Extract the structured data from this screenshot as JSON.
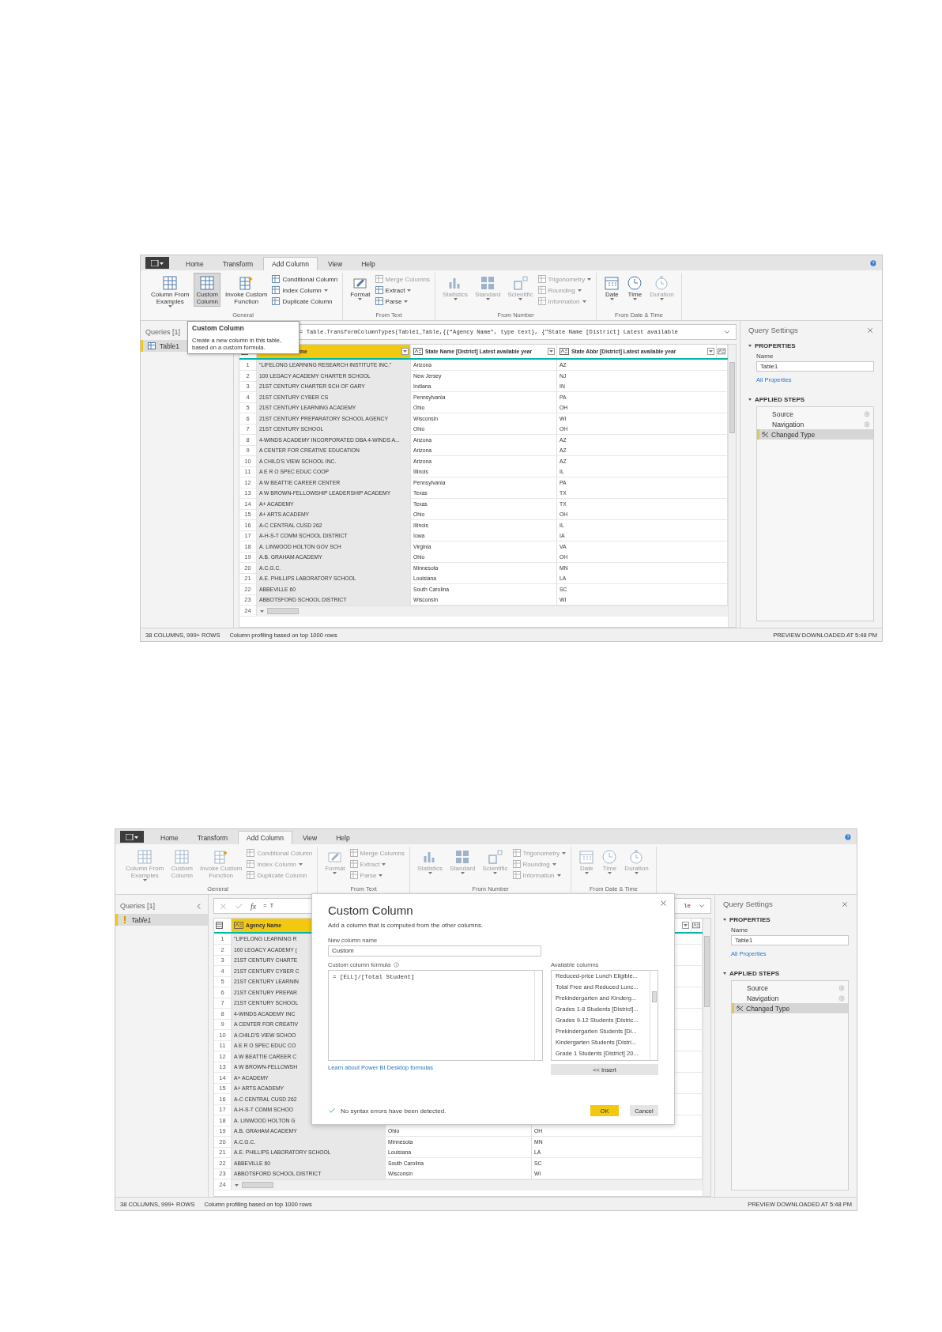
{
  "screenshots": [
    {
      "tabs": [
        {
          "label": "Home",
          "selected": false
        },
        {
          "label": "Transform",
          "selected": false
        },
        {
          "label": "Add Column",
          "selected": true
        },
        {
          "label": "View",
          "selected": false
        },
        {
          "label": "Help",
          "selected": false
        }
      ],
      "ribbon": {
        "groups": [
          {
            "label": "General",
            "buttons": [
              {
                "kind": "large",
                "lines": [
                  "Column From",
                  "Examples"
                ],
                "dropdown": true,
                "disabled": false,
                "highlighted": false
              },
              {
                "kind": "large",
                "lines": [
                  "Custom",
                  "Column"
                ],
                "dropdown": false,
                "disabled": false,
                "highlighted": true
              },
              {
                "kind": "large",
                "lines": [
                  "Invoke Custom",
                  "Function"
                ],
                "dropdown": false,
                "disabled": false,
                "highlighted": false
              },
              {
                "kind": "small",
                "label": "Conditional Column",
                "dropdown": false,
                "disabled": false
              },
              {
                "kind": "small",
                "label": "Index Column",
                "dropdown": true,
                "disabled": false
              },
              {
                "kind": "small",
                "label": "Duplicate Column",
                "dropdown": false,
                "disabled": false
              }
            ]
          },
          {
            "label": "From Text",
            "buttons": [
              {
                "kind": "large",
                "lines": [
                  "Format"
                ],
                "dropdown": true,
                "disabled": false,
                "highlighted": false
              },
              {
                "kind": "small",
                "label": "Merge Columns",
                "dropdown": false,
                "disabled": true
              },
              {
                "kind": "small",
                "label": "Extract",
                "dropdown": true,
                "disabled": false
              },
              {
                "kind": "small",
                "label": "Parse",
                "dropdown": true,
                "disabled": false
              }
            ]
          },
          {
            "label": "From Number",
            "buttons": [
              {
                "kind": "large",
                "lines": [
                  "Statistics"
                ],
                "dropdown": true,
                "disabled": true,
                "highlighted": false
              },
              {
                "kind": "large",
                "lines": [
                  "Standard"
                ],
                "dropdown": true,
                "disabled": true,
                "highlighted": false
              },
              {
                "kind": "large",
                "lines": [
                  "Scientific"
                ],
                "dropdown": true,
                "disabled": true,
                "highlighted": false
              },
              {
                "kind": "small",
                "label": "Trigonometry",
                "dropdown": true,
                "disabled": true
              },
              {
                "kind": "small",
                "label": "Rounding",
                "dropdown": true,
                "disabled": true
              },
              {
                "kind": "small",
                "label": "Information",
                "dropdown": true,
                "disabled": true
              }
            ]
          },
          {
            "label": "From Date & Time",
            "buttons": [
              {
                "kind": "large",
                "lines": [
                  "Date"
                ],
                "dropdown": true,
                "disabled": false,
                "highlighted": false
              },
              {
                "kind": "large",
                "lines": [
                  "Time"
                ],
                "dropdown": true,
                "disabled": false,
                "highlighted": false
              },
              {
                "kind": "large",
                "lines": [
                  "Duration"
                ],
                "dropdown": true,
                "disabled": true,
                "highlighted": false
              }
            ]
          }
        ]
      },
      "queries": {
        "title": "Queries [1]",
        "items": [
          {
            "label": "Table1",
            "selected": true,
            "warning": false
          }
        ]
      },
      "formula_bar": {
        "controls": false,
        "text": "= Table.TransformColumnTypes(Table1_Table,{{\"Agency Name\", type text}, {\"State Name [District] Latest available"
      },
      "grid": {
        "columns": [
          {
            "label": "me",
            "selected": true,
            "type_icon": false,
            "dropdown": true
          },
          {
            "label": "State Name [District] Latest available year",
            "selected": false,
            "type_icon": true,
            "dropdown": true
          },
          {
            "label": "State Abbr [District] Latest available year",
            "selected": false,
            "type_icon": true,
            "dropdown": true
          }
        ],
        "rows": [
          {
            "n": "1",
            "cells": [
              "\"LIFELONG LEARNING RESEARCH INSTITUTE INC.\"",
              "Arizona",
              "AZ"
            ]
          },
          {
            "n": "2",
            "cells": [
              "100 LEGACY ACADEMY CHARTER SCHOOL",
              "New Jersey",
              "NJ"
            ]
          },
          {
            "n": "3",
            "cells": [
              "21ST CENTURY CHARTER SCH OF GARY",
              "Indiana",
              "IN"
            ]
          },
          {
            "n": "4",
            "cells": [
              "21ST CENTURY CYBER CS",
              "Pennsylvania",
              "PA"
            ]
          },
          {
            "n": "5",
            "cells": [
              "21ST CENTURY LEARNING ACADEMY",
              "Ohio",
              "OH"
            ]
          },
          {
            "n": "6",
            "cells": [
              "21ST CENTURY PREPARATORY SCHOOL AGENCY",
              "Wisconsin",
              "WI"
            ]
          },
          {
            "n": "7",
            "cells": [
              "21ST CENTURY SCHOOL",
              "Ohio",
              "OH"
            ]
          },
          {
            "n": "8",
            "cells": [
              "4-WINDS ACADEMY INCORPORATED DBA 4-WINDS A...",
              "Arizona",
              "AZ"
            ]
          },
          {
            "n": "9",
            "cells": [
              "A CENTER FOR CREATIVE EDUCATION",
              "Arizona",
              "AZ"
            ]
          },
          {
            "n": "10",
            "cells": [
              "A CHILD'S VIEW SCHOOL INC.",
              "Arizona",
              "AZ"
            ]
          },
          {
            "n": "11",
            "cells": [
              "A E R O SPEC EDUC COOP",
              "Illinois",
              "IL"
            ]
          },
          {
            "n": "12",
            "cells": [
              "A W BEATTIE CAREER CENTER",
              "Pennsylvania",
              "PA"
            ]
          },
          {
            "n": "13",
            "cells": [
              "A W BROWN-FELLOWSHIP LEADERSHIP ACADEMY",
              "Texas",
              "TX"
            ]
          },
          {
            "n": "14",
            "cells": [
              "A+ ACADEMY",
              "Texas",
              "TX"
            ]
          },
          {
            "n": "15",
            "cells": [
              "A+ ARTS ACADEMY",
              "Ohio",
              "OH"
            ]
          },
          {
            "n": "16",
            "cells": [
              "A-C CENTRAL CUSD 262",
              "Illinois",
              "IL"
            ]
          },
          {
            "n": "17",
            "cells": [
              "A-H-S-T COMM SCHOOL DISTRICT",
              "Iowa",
              "IA"
            ]
          },
          {
            "n": "18",
            "cells": [
              "A. LINWOOD HOLTON GOV SCH",
              "Virginia",
              "VA"
            ]
          },
          {
            "n": "19",
            "cells": [
              "A.B. GRAHAM ACADEMY",
              "Ohio",
              "OH"
            ]
          },
          {
            "n": "20",
            "cells": [
              "A.C.G.C.",
              "Minnesota",
              "MN"
            ]
          },
          {
            "n": "21",
            "cells": [
              "A.E. PHILLIPS LABORATORY SCHOOL",
              "Louisiana",
              "LA"
            ]
          },
          {
            "n": "22",
            "cells": [
              "ABBEVILLE 60",
              "South Carolina",
              "SC"
            ]
          },
          {
            "n": "23",
            "cells": [
              "ABBOTSFORD SCHOOL DISTRICT",
              "Wisconsin",
              "WI"
            ]
          }
        ],
        "last_row": "24"
      },
      "settings": {
        "title": "Query Settings",
        "properties_heading": "PROPERTIES",
        "name_label": "Name",
        "name_value": "Table1",
        "link": "All Properties",
        "steps_heading": "APPLIED STEPS",
        "steps": [
          {
            "label": "Source",
            "selected": false,
            "kind": "configurable"
          },
          {
            "label": "Navigation",
            "selected": false,
            "kind": "configurable"
          },
          {
            "label": "Changed Type",
            "selected": true,
            "kind": "transform"
          }
        ]
      },
      "status": {
        "left": [
          "38 COLUMNS, 999+ ROWS",
          "Column profiling based on top 1000 rows"
        ],
        "right": "PREVIEW DOWNLOADED AT 5:48 PM"
      },
      "tooltip": {
        "title": "Custom Column",
        "text": "Create a new column in this table, based on a custom formula."
      }
    },
    {
      "tabs": [
        {
          "label": "Home",
          "selected": false
        },
        {
          "label": "Transform",
          "selected": false
        },
        {
          "label": "Add Column",
          "selected": true
        },
        {
          "label": "View",
          "selected": false
        },
        {
          "label": "Help",
          "selected": false
        }
      ],
      "ribbon": {
        "groups": [
          {
            "label": "General",
            "buttons": [
              {
                "kind": "large",
                "lines": [
                  "Column From",
                  "Examples"
                ],
                "dropdown": true,
                "disabled": true,
                "highlighted": false
              },
              {
                "kind": "large",
                "lines": [
                  "Custom",
                  "Column"
                ],
                "dropdown": false,
                "disabled": true,
                "highlighted": false
              },
              {
                "kind": "large",
                "lines": [
                  "Invoke Custom",
                  "Function"
                ],
                "dropdown": false,
                "disabled": true,
                "highlighted": false
              },
              {
                "kind": "small",
                "label": "Conditional Column",
                "dropdown": false,
                "disabled": true
              },
              {
                "kind": "small",
                "label": "Index Column",
                "dropdown": true,
                "disabled": true
              },
              {
                "kind": "small",
                "label": "Duplicate Column",
                "dropdown": false,
                "disabled": true
              }
            ]
          },
          {
            "label": "From Text",
            "buttons": [
              {
                "kind": "large",
                "lines": [
                  "Format"
                ],
                "dropdown": true,
                "disabled": true,
                "highlighted": false
              },
              {
                "kind": "small",
                "label": "Merge Columns",
                "dropdown": false,
                "disabled": true
              },
              {
                "kind": "small",
                "label": "Extract",
                "dropdown": true,
                "disabled": true
              },
              {
                "kind": "small",
                "label": "Parse",
                "dropdown": true,
                "disabled": true
              }
            ]
          },
          {
            "label": "From Number",
            "buttons": [
              {
                "kind": "large",
                "lines": [
                  "Statistics"
                ],
                "dropdown": true,
                "disabled": true,
                "highlighted": false
              },
              {
                "kind": "large",
                "lines": [
                  "Standard"
                ],
                "dropdown": true,
                "disabled": true,
                "highlighted": false
              },
              {
                "kind": "large",
                "lines": [
                  "Scientific"
                ],
                "dropdown": true,
                "disabled": true,
                "highlighted": false
              },
              {
                "kind": "small",
                "label": "Trigonometry",
                "dropdown": true,
                "disabled": true
              },
              {
                "kind": "small",
                "label": "Rounding",
                "dropdown": true,
                "disabled": true
              },
              {
                "kind": "small",
                "label": "Information",
                "dropdown": true,
                "disabled": true
              }
            ]
          },
          {
            "label": "From Date & Time",
            "buttons": [
              {
                "kind": "large",
                "lines": [
                  "Date"
                ],
                "dropdown": true,
                "disabled": true,
                "highlighted": false
              },
              {
                "kind": "large",
                "lines": [
                  "Time"
                ],
                "dropdown": true,
                "disabled": true,
                "highlighted": false
              },
              {
                "kind": "large",
                "lines": [
                  "Duration"
                ],
                "dropdown": true,
                "disabled": true,
                "highlighted": false
              }
            ]
          }
        ]
      },
      "queries": {
        "title": "Queries [1]",
        "items": [
          {
            "label": "Table1",
            "selected": true,
            "warning": true
          }
        ]
      },
      "formula_bar": {
        "controls": true,
        "fx": "fx",
        "text": "= T",
        "tail": "le"
      },
      "grid": {
        "columns": [
          {
            "label": "Agency Name",
            "selected": true,
            "type_icon": true,
            "dropdown": false
          },
          {},
          {
            "selected": false,
            "type_icon": false,
            "dropdown": true
          }
        ],
        "rows": [
          {
            "n": "1",
            "cells": [
              "\"LIFELONG LEARNING R"
            ]
          },
          {
            "n": "2",
            "cells": [
              "100 LEGACY ACADEMY ("
            ]
          },
          {
            "n": "3",
            "cells": [
              "21ST CENTURY CHARTE"
            ]
          },
          {
            "n": "4",
            "cells": [
              "21ST CENTURY CYBER C"
            ]
          },
          {
            "n": "5",
            "cells": [
              "21ST CENTURY LEARNIN"
            ]
          },
          {
            "n": "6",
            "cells": [
              "21ST CENTURY PREPAR"
            ]
          },
          {
            "n": "7",
            "cells": [
              "21ST CENTURY SCHOOL"
            ]
          },
          {
            "n": "8",
            "cells": [
              "4-WINDS ACADEMY INC"
            ]
          },
          {
            "n": "9",
            "cells": [
              "A CENTER FOR CREATIV"
            ]
          },
          {
            "n": "10",
            "cells": [
              "A CHILD'S VIEW SCHOO"
            ]
          },
          {
            "n": "11",
            "cells": [
              "A E R O SPEC EDUC CO"
            ]
          },
          {
            "n": "12",
            "cells": [
              "A W BEATTIE CAREER C"
            ]
          },
          {
            "n": "13",
            "cells": [
              "A W BROWN-FELLOWSH"
            ]
          },
          {
            "n": "14",
            "cells": [
              "A+ ACADEMY"
            ]
          },
          {
            "n": "15",
            "cells": [
              "A+ ARTS ACADEMY"
            ]
          },
          {
            "n": "16",
            "cells": [
              "A-C CENTRAL CUSD 262"
            ]
          },
          {
            "n": "17",
            "cells": [
              "A-H-S-T COMM SCHOO"
            ]
          },
          {
            "n": "18",
            "cells": [
              "A. LINWOOD HOLTON G"
            ]
          },
          {
            "n": "19",
            "cells": [
              "A.B. GRAHAM ACADEMY",
              "Ohio",
              "OH"
            ]
          },
          {
            "n": "20",
            "cells": [
              "A.C.G.C.",
              "Minnesota",
              "MN"
            ]
          },
          {
            "n": "21",
            "cells": [
              "A.E. PHILLIPS LABORATORY SCHOOL",
              "Louisiana",
              "LA"
            ]
          },
          {
            "n": "22",
            "cells": [
              "ABBEVILLE 60",
              "South Carolina",
              "SC"
            ]
          },
          {
            "n": "23",
            "cells": [
              "ABBOTSFORD SCHOOL DISTRICT",
              "Wisconsin",
              "WI"
            ]
          }
        ],
        "last_row": "24"
      },
      "settings": {
        "title": "Query Settings",
        "properties_heading": "PROPERTIES",
        "name_label": "Name",
        "name_value": "Table1",
        "link": "All Properties",
        "steps_heading": "APPLIED STEPS",
        "steps": [
          {
            "label": "Source",
            "selected": false,
            "kind": "configurable"
          },
          {
            "label": "Navigation",
            "selected": false,
            "kind": "configurable"
          },
          {
            "label": "Changed Type",
            "selected": true,
            "kind": "transform"
          }
        ]
      },
      "status": {
        "left": [
          "38 COLUMNS, 999+ ROWS",
          "Column profiling based on top 1000 rows"
        ],
        "right": "PREVIEW DOWNLOADED AT 5:48 PM"
      },
      "dialog": {
        "title": "Custom Column",
        "subtitle": "Add a column that is computed from the other columns.",
        "name_label": "New column name",
        "name_value": "Custom",
        "formula_label": "Custom column formula",
        "formula": "= [ELL]/[Total Student]",
        "available_label": "Available columns",
        "available": [
          "Reduced-price Lunch Eligible...",
          "Total Free and Reduced Lunc...",
          "Prekindergarten and Kinderg...",
          "Grades 1-8 Students [District]...",
          "Grades 9-12 Students [Distric...",
          "Prekindergarten Students [Di...",
          "Kindergarten Students [Distri...",
          "Grade 1 Students [District] 20..."
        ],
        "insert": "<< Insert",
        "link": "Learn about Power BI Desktop formulas",
        "message": "No syntax errors have been detected.",
        "buttons": [
          {
            "label": "OK",
            "primary": true
          },
          {
            "label": "Cancel",
            "primary": false
          }
        ]
      }
    }
  ]
}
